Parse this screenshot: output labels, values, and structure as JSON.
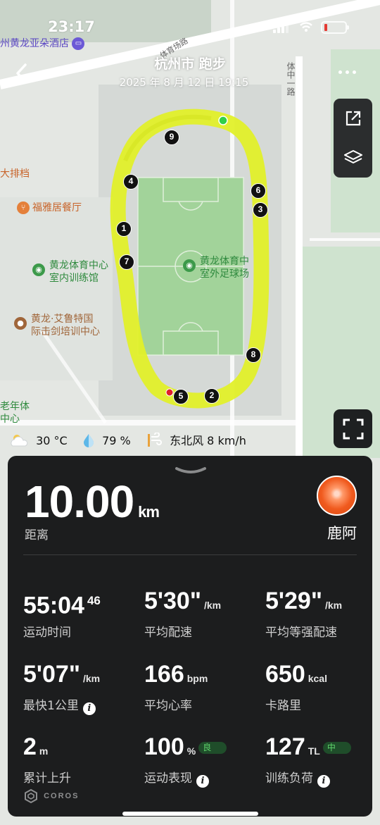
{
  "status": {
    "time": "23:17"
  },
  "header": {
    "title": "杭州市 跑步",
    "subtitle": "2025 年 8 月 12 日 19:15"
  },
  "map": {
    "pois": [
      {
        "name": "州黄龙亚朵酒店",
        "kind": "hotel"
      },
      {
        "name": "大排档",
        "kind": "orange"
      },
      {
        "name": "福雅居餐厅",
        "kind": "orange"
      },
      {
        "name": "黄龙体育中心",
        "line2": "室内训练馆",
        "kind": "green"
      },
      {
        "name": "黄龙体育中",
        "line2": "室外足球场",
        "kind": "green"
      },
      {
        "name": "黄龙·艾鲁特国",
        "line2": "际击剑培训中心",
        "kind": "brown"
      },
      {
        "name": "老年体",
        "line2": "中心",
        "kind": "green"
      }
    ],
    "roads": [
      "体育场路",
      "体中一路"
    ],
    "lap_markers": [
      "1",
      "2",
      "3",
      "4",
      "5",
      "6",
      "7",
      "8",
      "9"
    ],
    "route_color": "#e2f02a"
  },
  "weather": {
    "temperature": "30 °C",
    "humidity": "79 %",
    "wind": "东北风 8 km/h"
  },
  "summary": {
    "distance": "10.00",
    "distance_unit": "km",
    "distance_label": "距离",
    "username": "鹿阿"
  },
  "stats": {
    "duration": {
      "value": "55:04",
      "sup": "46",
      "label": "运动时间"
    },
    "avg_pace": {
      "value": "5'30\"",
      "unit": "/km",
      "label": "平均配速"
    },
    "avg_grade_pace": {
      "value": "5'29\"",
      "unit": "/km",
      "label": "平均等强配速"
    },
    "fastest_km": {
      "value": "5'07\"",
      "unit": "/km",
      "label": "最快1公里"
    },
    "avg_hr": {
      "value": "166",
      "unit": "bpm",
      "label": "平均心率"
    },
    "calories": {
      "value": "650",
      "unit": "kcal",
      "label": "卡路里"
    },
    "ascent": {
      "value": "2",
      "unit": "m",
      "label": "累计上升"
    },
    "performance": {
      "value": "100",
      "unit": "%",
      "badge": "良",
      "label": "运动表现"
    },
    "training_load": {
      "value": "127",
      "unit": "TL",
      "badge": "中",
      "label": "训练负荷"
    }
  },
  "brand": "COROS"
}
